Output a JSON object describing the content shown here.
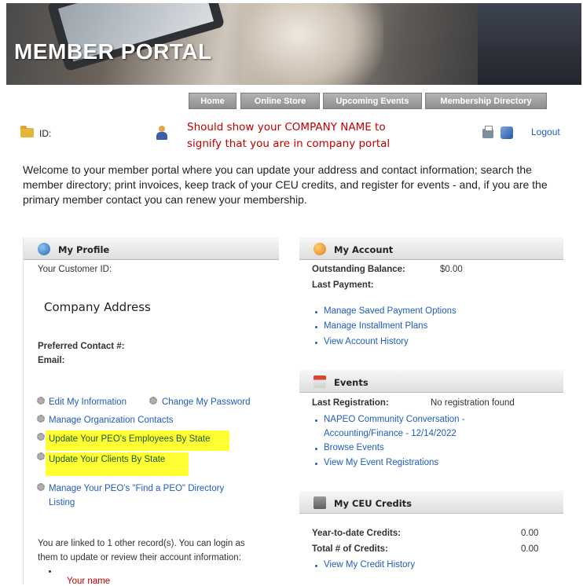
{
  "banner": {
    "title": "MEMBER PORTAL"
  },
  "nav": {
    "tabs": [
      "Home",
      "Online Store",
      "Upcoming Events",
      "Membership Directory"
    ]
  },
  "util": {
    "id_label": "ID:",
    "note_line1": "Should show your COMPANY NAME to",
    "note_line2": "signify that you are in company portal",
    "logout_label": "Logout"
  },
  "welcome": "Welcome to your member portal where you can update your address and contact information; search the member directory; print invoices, keep track of your CEU credits, and register for events - and, if you are the primary member contact you can renew your membership.",
  "profile": {
    "title": "My Profile",
    "customer_id_label": "Your Customer ID:",
    "company_address": "Company Address",
    "preferred_contact_label": "Preferred Contact #:",
    "email_label": "Email:",
    "edit_info": "Edit My Information",
    "change_password": "Change My Password",
    "manage_contacts": "Manage Organization Contacts",
    "update_employees": "Update Your PEO's Employees By State",
    "update_clients": "Update Your Clients By State",
    "manage_listing_line1": "Manage Your PEO's \"Find a PEO\" Directory",
    "manage_listing_line2": "Listing",
    "linked_line1": "You are linked to 1 other record(s). You can login as",
    "linked_line2": "them to update or review their account information:",
    "linked_name": "Your name"
  },
  "account": {
    "title": "My Account",
    "balance_label": "Outstanding Balance:",
    "balance_value": "$0.00",
    "last_payment_label": "Last Payment:",
    "links": [
      "Manage Saved Payment Options",
      "Manage Installment Plans",
      "View Account History"
    ]
  },
  "events": {
    "title": "Events",
    "last_reg_label": "Last Registration:",
    "last_reg_value": "No registration found",
    "event_line1": "NAPEO Community Conversation -",
    "event_line2": "Accounting/Finance - 12/14/2022",
    "browse": "Browse Events",
    "view_regs": "View My Event Registrations"
  },
  "ceu": {
    "title": "My CEU Credits",
    "ytd_label": "Year-to-date Credits:",
    "ytd_value": "0.00",
    "total_label": "Total # of Credits:",
    "total_value": "0.00",
    "history": "View My Credit History"
  }
}
